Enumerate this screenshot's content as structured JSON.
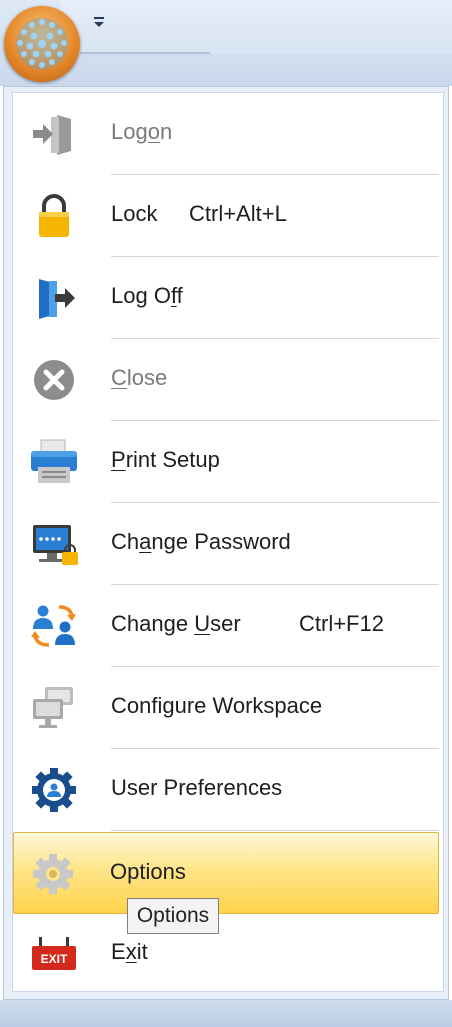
{
  "menu": {
    "items": [
      {
        "id": "logon",
        "pre": "Log",
        "key": "o",
        "post": "n",
        "shortcut": "",
        "enabled": false,
        "icon": "logon-door-icon"
      },
      {
        "id": "lock",
        "pre": "Lock",
        "key": "",
        "post": "",
        "shortcut": "Ctrl+Alt+L",
        "enabled": true,
        "icon": "padlock-icon"
      },
      {
        "id": "logoff",
        "pre": "Log O",
        "key": "f",
        "post": "f",
        "shortcut": "",
        "enabled": true,
        "icon": "logoff-door-icon"
      },
      {
        "id": "close",
        "pre": "",
        "key": "C",
        "post": "lose",
        "shortcut": "",
        "enabled": false,
        "icon": "close-circle-icon"
      },
      {
        "id": "print-setup",
        "pre": "",
        "key": "P",
        "post": "rint Setup",
        "shortcut": "",
        "enabled": true,
        "icon": "printer-icon"
      },
      {
        "id": "change-password",
        "pre": "Ch",
        "key": "a",
        "post": "nge Password",
        "shortcut": "",
        "enabled": true,
        "icon": "monitor-lock-icon"
      },
      {
        "id": "change-user",
        "pre": "Change ",
        "key": "U",
        "post": "ser",
        "shortcut": "Ctrl+F12",
        "enabled": true,
        "icon": "users-swap-icon"
      },
      {
        "id": "configure-workspace",
        "pre": "Configure Workspace",
        "key": "",
        "post": "",
        "shortcut": "",
        "enabled": true,
        "icon": "workspace-monitors-icon"
      },
      {
        "id": "user-preferences",
        "pre": "User Preferences",
        "key": "",
        "post": "",
        "shortcut": "",
        "enabled": true,
        "icon": "user-gear-icon"
      },
      {
        "id": "options",
        "pre": "Options",
        "key": "",
        "post": "",
        "shortcut": "",
        "enabled": true,
        "icon": "options-gear-icon",
        "highlighted": true
      },
      {
        "id": "exit",
        "pre": "E",
        "key": "x",
        "post": "it",
        "shortcut": "",
        "enabled": true,
        "icon": "exit-sign-icon"
      }
    ]
  },
  "tooltip": {
    "text": "Options"
  },
  "colors": {
    "highlight": "#ffd24a",
    "menu_text": "#1e1e1e",
    "disabled_text": "#7a7a7a",
    "accent_blue": "#2a7fd4",
    "app_orb": "#e78a2c"
  }
}
